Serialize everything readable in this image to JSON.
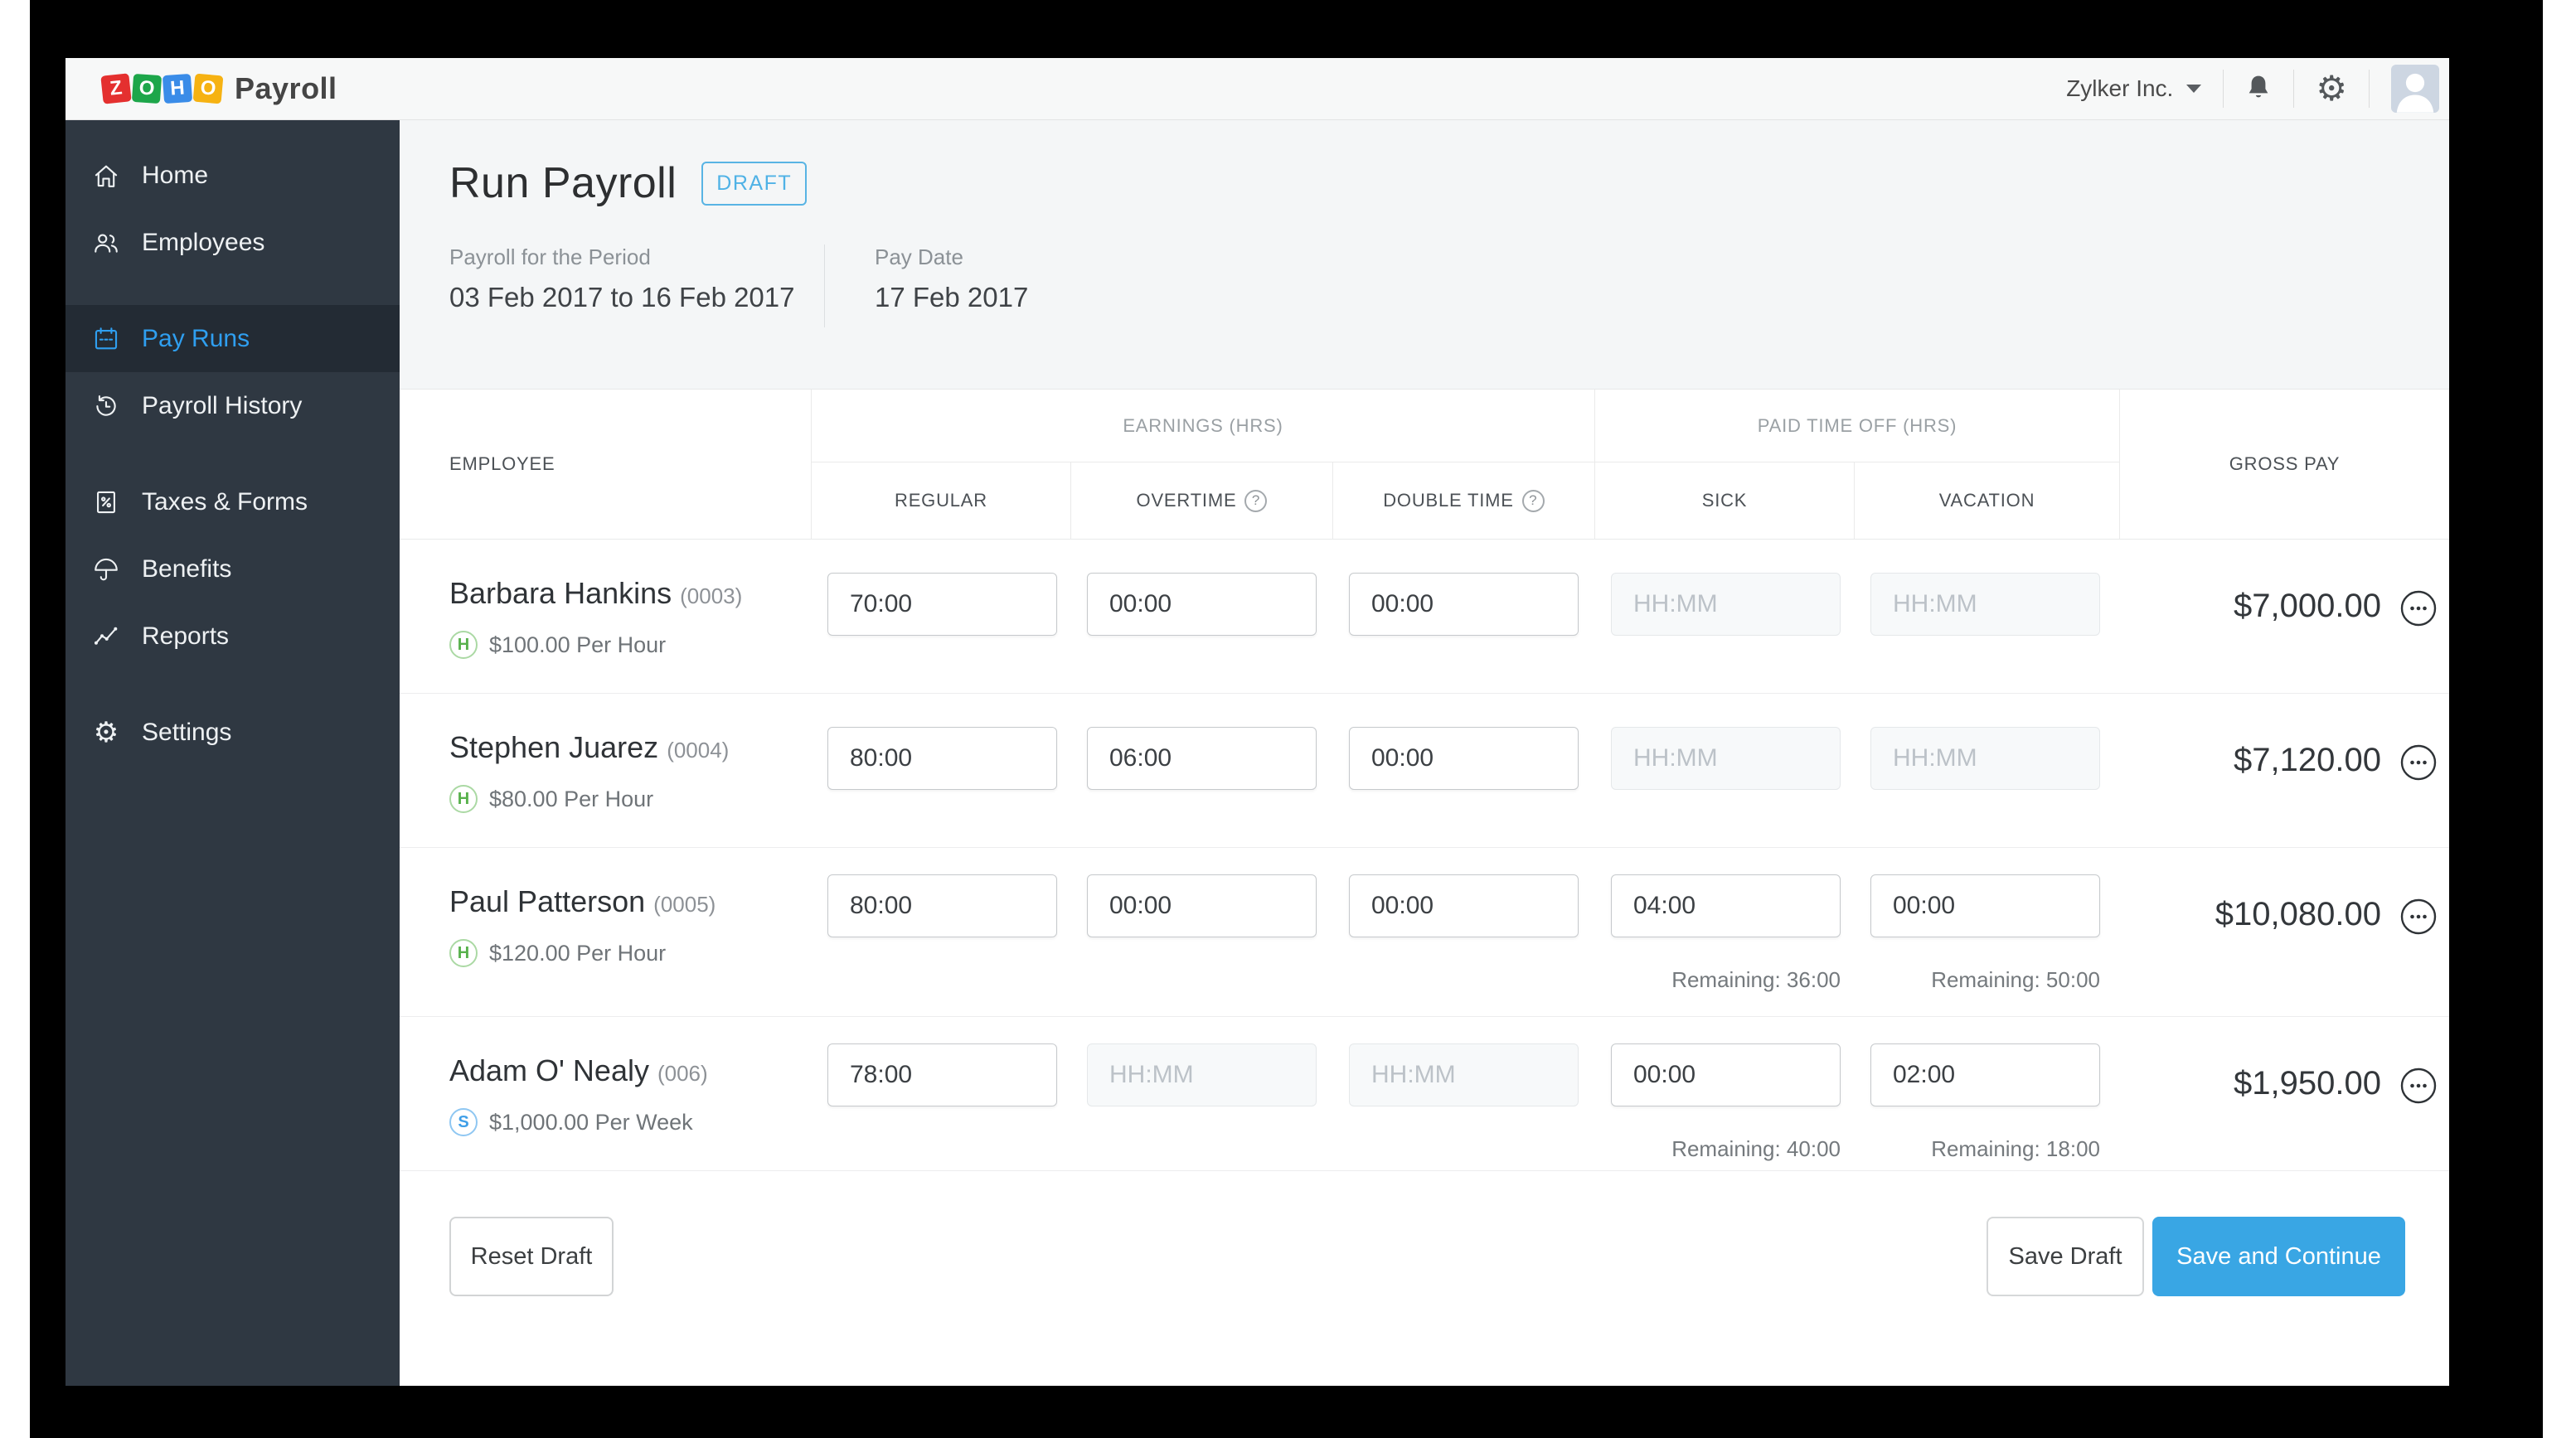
{
  "topbar": {
    "logo": {
      "tiles": [
        {
          "letter": "Z",
          "color": "#e4302f"
        },
        {
          "letter": "O",
          "color": "#1da64a"
        },
        {
          "letter": "H",
          "color": "#3a8ce8"
        },
        {
          "letter": "O",
          "color": "#f6b212"
        }
      ],
      "product": "Payroll"
    },
    "company": "Zylker Inc."
  },
  "sidebar": {
    "items": [
      {
        "label": "Home"
      },
      {
        "label": "Employees"
      },
      {
        "label": "Pay Runs",
        "active": true
      },
      {
        "label": "Payroll History"
      },
      {
        "label": "Taxes & Forms"
      },
      {
        "label": "Benefits"
      },
      {
        "label": "Reports"
      },
      {
        "label": "Settings"
      }
    ]
  },
  "header": {
    "title": "Run Payroll",
    "status_badge": "DRAFT",
    "period_label": "Payroll for the Period",
    "period_value": "03 Feb 2017 to 16 Feb 2017",
    "pay_date_label": "Pay Date",
    "pay_date_value": "17 Feb 2017"
  },
  "table": {
    "group_headers": {
      "earnings": "EARNINGS (HRS)",
      "pto": "PAID TIME OFF (HRS)"
    },
    "columns": {
      "employee": "EMPLOYEE",
      "regular": "REGULAR",
      "overtime": "OVERTIME",
      "double_time": "DOUBLE TIME",
      "sick": "SICK",
      "vacation": "VACATION",
      "gross_pay": "GROSS PAY"
    },
    "help_icon_glyph": "?"
  },
  "employees": [
    {
      "name": "Barbara Hankins",
      "code": "(0003)",
      "pay_type": "H",
      "rate": "$100.00 Per Hour",
      "hours": {
        "regular": {
          "value": "70:00"
        },
        "overtime": {
          "value": "00:00"
        },
        "double_time": {
          "value": "00:00"
        },
        "sick": {
          "placeholder": "HH:MM",
          "disabled": true
        },
        "vacation": {
          "placeholder": "HH:MM",
          "disabled": true
        }
      },
      "gross_pay": "$7,000.00"
    },
    {
      "name": "Stephen Juarez",
      "code": "(0004)",
      "pay_type": "H",
      "rate": "$80.00 Per Hour",
      "hours": {
        "regular": {
          "value": "80:00"
        },
        "overtime": {
          "value": "06:00"
        },
        "double_time": {
          "value": "00:00"
        },
        "sick": {
          "placeholder": "HH:MM",
          "disabled": true
        },
        "vacation": {
          "placeholder": "HH:MM",
          "disabled": true
        }
      },
      "gross_pay": "$7,120.00"
    },
    {
      "name": "Paul Patterson",
      "code": "(0005)",
      "pay_type": "H",
      "rate": "$120.00 Per Hour",
      "hours": {
        "regular": {
          "value": "80:00"
        },
        "overtime": {
          "value": "00:00"
        },
        "double_time": {
          "value": "00:00"
        },
        "sick": {
          "value": "04:00",
          "remaining": "Remaining: 36:00"
        },
        "vacation": {
          "value": "00:00",
          "remaining": "Remaining: 50:00"
        }
      },
      "gross_pay": "$10,080.00"
    },
    {
      "name": "Adam O' Nealy",
      "code": "(006)",
      "pay_type": "S",
      "rate": "$1,000.00 Per Week",
      "hours": {
        "regular": {
          "value": "78:00"
        },
        "overtime": {
          "placeholder": "HH:MM",
          "disabled": true
        },
        "double_time": {
          "placeholder": "HH:MM",
          "disabled": true
        },
        "sick": {
          "value": "00:00",
          "remaining": "Remaining: 40:00"
        },
        "vacation": {
          "value": "02:00",
          "remaining": "Remaining: 18:00"
        }
      },
      "gross_pay": "$1,950.00"
    }
  ],
  "footer": {
    "reset_label": "Reset Draft",
    "save_draft_label": "Save Draft",
    "save_continue_label": "Save and Continue"
  },
  "colors": {
    "accent_blue": "#2f9ff0",
    "draft_badge_blue": "#4fb2e6",
    "primary_button_blue": "#39a6e4",
    "hourly_badge_green": "#58b14c",
    "salary_badge_blue": "#3f9fe8",
    "sidebar_bg": "#2f3842",
    "sidebar_active_bg": "#232b34",
    "header_band_bg": "#f4f6f7"
  }
}
